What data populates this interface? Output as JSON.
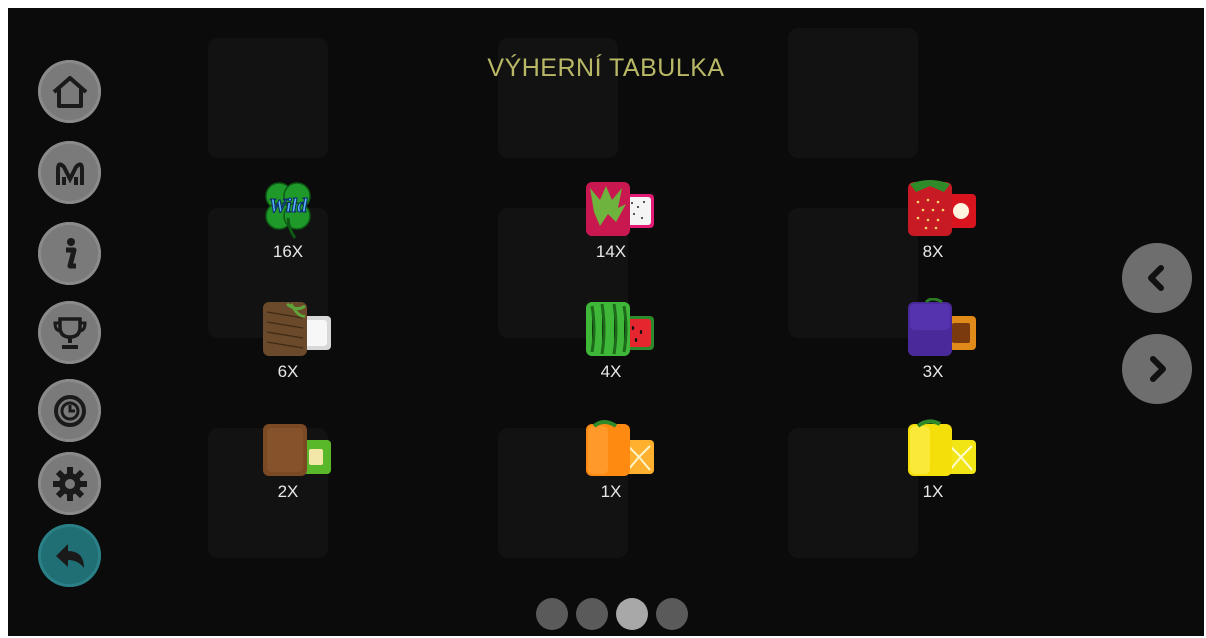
{
  "title": "VÝHERNÍ TABULKA",
  "sidebar": {
    "buttons": [
      {
        "icon": "home-icon"
      },
      {
        "icon": "game-logo-icon"
      },
      {
        "icon": "info-icon"
      },
      {
        "icon": "trophy-icon"
      },
      {
        "icon": "history-icon"
      },
      {
        "icon": "settings-icon"
      },
      {
        "icon": "back-arrow-icon"
      }
    ]
  },
  "nav": {
    "prev_icon": "chevron-left-icon",
    "next_icon": "chevron-right-icon"
  },
  "paytable": [
    {
      "symbol": "wild-clover",
      "multiplier": "16X",
      "wild_text": "Wild"
    },
    {
      "symbol": "dragon-fruit",
      "multiplier": "14X"
    },
    {
      "symbol": "strawberry",
      "multiplier": "8X"
    },
    {
      "symbol": "coconut",
      "multiplier": "6X"
    },
    {
      "symbol": "watermelon",
      "multiplier": "4X"
    },
    {
      "symbol": "plum",
      "multiplier": "3X"
    },
    {
      "symbol": "kiwi",
      "multiplier": "2X"
    },
    {
      "symbol": "orange",
      "multiplier": "1X"
    },
    {
      "symbol": "lemon",
      "multiplier": "1X"
    }
  ],
  "pagination": {
    "pages": 4,
    "current": 3
  },
  "colors": {
    "title": "#b8b866",
    "back_button": "#1f6f74",
    "button_gray": "#7a7a7a"
  }
}
